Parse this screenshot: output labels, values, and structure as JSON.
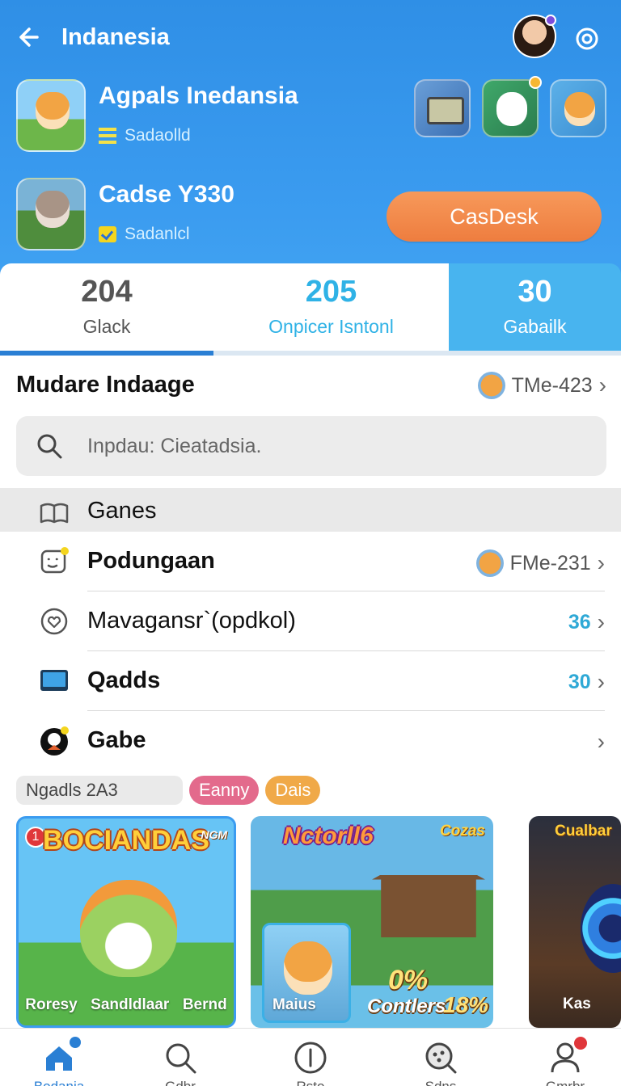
{
  "header": {
    "title": "Indanesia",
    "cta_label": "CasDesk"
  },
  "games": [
    {
      "name": "Agpals Inedansia",
      "status": "Sadaolld"
    },
    {
      "name": "Cadse Y330",
      "status": "Sadanlcl"
    }
  ],
  "stats": [
    {
      "value": "204",
      "label": "Glack"
    },
    {
      "value": "205",
      "label": "Onpicer Isntonl"
    },
    {
      "value": "30",
      "label": "Gabailk"
    }
  ],
  "section": {
    "title": "Mudare Indaage",
    "link": "TMe-423"
  },
  "search": {
    "placeholder": "Inpdau: Cieatadsia."
  },
  "menu": [
    {
      "label": "Ganes",
      "icon": "book-icon"
    },
    {
      "label": "Podungaan",
      "icon": "chat-icon",
      "right": "FMe-231"
    },
    {
      "label": "Mavagansr`(opdkol)",
      "icon": "settings-icon",
      "count": "36"
    },
    {
      "label": "Qadds",
      "icon": "screen-icon",
      "count": "30"
    },
    {
      "label": "Gabe",
      "icon": "character-icon"
    }
  ],
  "tags": {
    "search_label": "Ngadls 2A3",
    "tag1": "Eanny",
    "tag2": "Dais"
  },
  "cards": [
    {
      "badge": "1",
      "title": "BOCIANDAS",
      "corner": "NGM",
      "captions": [
        "Roresy",
        "Sandldlaar",
        "Bernd"
      ]
    },
    {
      "title": "Nctorll6",
      "corner": "Cozas",
      "inset_label": "Maius",
      "stat_big": "0%",
      "stat_mid": "Contlers",
      "stat_pct": "18%"
    },
    {
      "corner": "Cualbar",
      "label": "Kas"
    }
  ],
  "nav": [
    {
      "label": "Bodania",
      "icon": "home-icon"
    },
    {
      "label": "Gdbr",
      "icon": "search-icon"
    },
    {
      "label": "Rsto",
      "icon": "info-icon"
    },
    {
      "label": "Sdns",
      "icon": "discover-icon"
    },
    {
      "label": "Gmrbr",
      "icon": "profile-icon"
    }
  ],
  "colors": {
    "header_blue": "#3b9cf0",
    "cta_orange": "#ee7d3f",
    "accent_cyan": "#2fb2e6"
  }
}
